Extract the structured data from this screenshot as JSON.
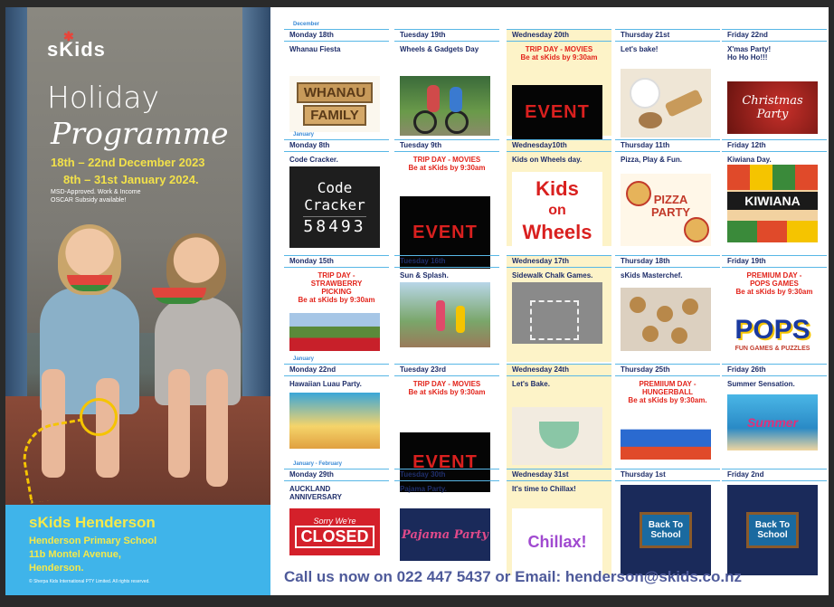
{
  "poster": {
    "brand": "sKids",
    "title_line1": "Holiday",
    "title_line2": "Programme",
    "dates_line1": "18th – 22nd December 2023",
    "dates_line2": "8th – 31st January 2024.",
    "subsidy": "MSD-Approved. Work & Income OSCAR Subsidy available!",
    "centre_name": "sKids Henderson",
    "school": "Henderson Primary School",
    "address_street": "11b Montel Avenue,",
    "address_suburb": "Henderson.",
    "copyright": "© Sherpa Kids International PTY Limited. All rights reserved."
  },
  "colors": {
    "brand_blue": "#3fb4ea",
    "highlight_yellow": "#f5e94a",
    "trip_red": "#e2231a",
    "header_navy": "#1f2e6a"
  },
  "weeks": [
    {
      "label": "December",
      "days": [
        {
          "head": "Monday 18th",
          "title": "Whanau Fiesta",
          "img": "whanau-family",
          "highlight": false,
          "trip": false
        },
        {
          "head": "Tuesday 19th",
          "title": "Wheels & Gadgets Day",
          "img": "bikes",
          "highlight": false,
          "trip": false
        },
        {
          "head": "Wednesday 20th",
          "title": "TRIP DAY - MOVIES\nBe at sKids by 9:30am",
          "img": "event-cinemas",
          "highlight": true,
          "trip": true
        },
        {
          "head": "Thursday 21st",
          "title": "Let's bake!",
          "img": "baking",
          "highlight": false,
          "trip": false
        },
        {
          "head": "Friday 22nd",
          "title": "X'mas Party!\nHo Ho Ho!!!",
          "img": "christmas",
          "highlight": false,
          "trip": false
        }
      ]
    },
    {
      "label": "January",
      "days": [
        {
          "head": "Monday 8th",
          "title": "Code Cracker.",
          "img": "code-cracker",
          "highlight": false,
          "trip": false
        },
        {
          "head": "Tuesday 9th",
          "title": "TRIP DAY - MOVIES\nBe at sKids by 9:30am",
          "img": "event-cinemas",
          "highlight": false,
          "trip": true
        },
        {
          "head": "Wednesday10th",
          "title": "Kids on Wheels day.",
          "img": "kids-on-wheels",
          "highlight": true,
          "trip": false
        },
        {
          "head": "Thursday 11th",
          "title": "Pizza, Play & Fun.",
          "img": "pizza-party",
          "highlight": false,
          "trip": false
        },
        {
          "head": "Friday 12th",
          "title": "Kiwiana Day.",
          "img": "kiwiana",
          "highlight": false,
          "trip": false
        }
      ]
    },
    {
      "label": "",
      "days": [
        {
          "head": "Monday 15th",
          "title": "TRIP DAY -\nSTRAWBERRY\nPICKING\nBe at sKids by 9:30am",
          "img": "strawberries",
          "highlight": false,
          "trip": true
        },
        {
          "head": "Tuesday 16th",
          "title": "Sun & Splash.",
          "img": "splash",
          "highlight": false,
          "trip": false
        },
        {
          "head": "Wednesday 17th",
          "title": "Sidewalk Chalk Games.",
          "img": "chalk",
          "highlight": true,
          "trip": false
        },
        {
          "head": "Thursday 18th",
          "title": "sKids Masterchef.",
          "img": "cookies",
          "highlight": false,
          "trip": false
        },
        {
          "head": "Friday 19th",
          "title": "PREMIUM DAY -\nPOPS GAMES\nBe at sKids by 9:30am",
          "img": "pops",
          "highlight": false,
          "trip": true
        }
      ]
    },
    {
      "label": "January",
      "days": [
        {
          "head": "Monday 22nd",
          "title": "Hawaiian Luau Party.",
          "img": "luau",
          "highlight": false,
          "trip": false
        },
        {
          "head": "Tuesday 23rd",
          "title": "TRIP DAY - MOVIES\nBe at sKids by 9:30am",
          "img": "event-cinemas",
          "highlight": false,
          "trip": true
        },
        {
          "head": "Wednesday 24th",
          "title": "Let's Bake.",
          "img": "bake-bowl",
          "highlight": true,
          "trip": false
        },
        {
          "head": "Thursday 25th",
          "title": "PREMIIUM DAY -\nHUNGERBALL\nBe at sKids by 9:30am.",
          "img": "hungerball",
          "highlight": false,
          "trip": true
        },
        {
          "head": "Friday 26th",
          "title": "Summer Sensation.",
          "img": "summer",
          "highlight": false,
          "trip": false
        }
      ]
    },
    {
      "label": "January - February",
      "days": [
        {
          "head": "Monday 29th",
          "title": "AUCKLAND\nANNIVERSARY",
          "img": "closed",
          "highlight": false,
          "trip": false
        },
        {
          "head": "Tuesday 30th",
          "title": "Pajama Party.",
          "img": "pajama",
          "highlight": false,
          "trip": false
        },
        {
          "head": "Wednesday 31st",
          "title": "It's time to Chillax!",
          "img": "chillax",
          "highlight": true,
          "trip": false
        },
        {
          "head": "Thursday 1st",
          "title": "",
          "img": "back-to-school",
          "highlight": false,
          "trip": false
        },
        {
          "head": "Friday 2nd",
          "title": "",
          "img": "back-to-school",
          "highlight": false,
          "trip": false
        }
      ]
    }
  ],
  "image_text": {
    "whanau": "WHANAU",
    "family": "FAMILY",
    "event": "EVENT",
    "code": "Code",
    "cracker": "Cracker",
    "code_digits": "58493",
    "kids": "Kids",
    "on": "on",
    "wheels": "Wheels",
    "pizza": "PIZZA",
    "party": "PARTY",
    "kiwiana": "KIWIANA",
    "christmas": "Christmas Party",
    "pops": "POPS",
    "pops_sub": "FUN GAMES & PUZZLES",
    "sorry": "Sorry We're",
    "closed": "CLOSED",
    "pajama": "Pajama Party",
    "chillax": "Chillax!",
    "back_to_school": "Back To School",
    "summer": "Summer"
  },
  "footer": "Call us now on 022 447 5437 or Email: henderson@skids.co.nz"
}
